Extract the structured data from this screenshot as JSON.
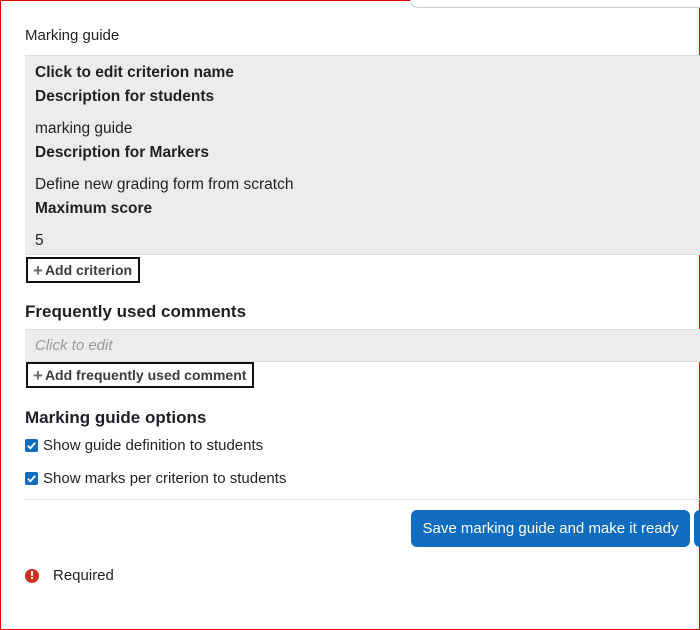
{
  "form": {
    "section_label": "Marking guide"
  },
  "criterion": {
    "name": "Click to edit criterion name",
    "desc_students_label": "Description for students",
    "desc_students_value": "marking guide",
    "desc_markers_label": "Description for Markers",
    "desc_markers_value": "Define new grading form from scratch",
    "max_score_label": "Maximum score",
    "max_score_value": "5"
  },
  "add_criterion_label": "Add criterion",
  "comments": {
    "heading": "Frequently used comments",
    "placeholder": "Click to edit",
    "add_label": "Add frequently used comment"
  },
  "options": {
    "heading": "Marking guide options",
    "items": [
      {
        "label": "Show guide definition to students",
        "checked": true
      },
      {
        "label": "Show marks per criterion to students",
        "checked": true
      }
    ]
  },
  "actions": {
    "save_label": "Save marking guide and make it ready"
  },
  "required_label": "Required",
  "colors": {
    "primary": "#0f6cbf",
    "required_icon": "#ca3120",
    "criterion_bg": "#ececec",
    "frame_border": "#e00000"
  },
  "icons": {
    "add": "plus-icon",
    "checkbox": "checkmark-icon",
    "required": "exclamation-circle-icon"
  }
}
